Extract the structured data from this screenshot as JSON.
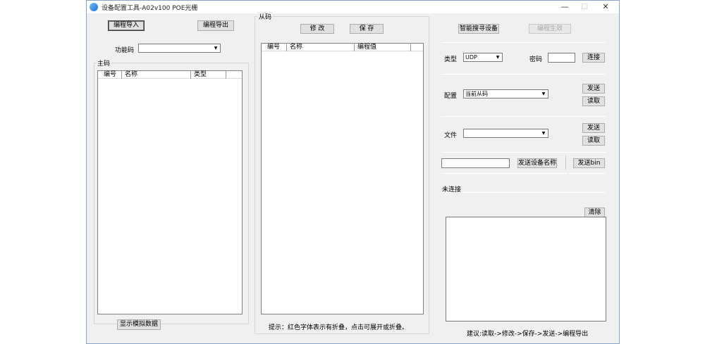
{
  "window": {
    "title": "设备配置工具-A02v100 POE光栅",
    "minimize": "—",
    "maximize": "☐",
    "close": "✕"
  },
  "left": {
    "import_button": "编程导入",
    "export_button": "编程导出",
    "function_code_label": "功能码",
    "function_code_value": "",
    "master_group_title": "主码",
    "master_columns": [
      "编号",
      "名称",
      "类型"
    ],
    "show_sim_button": "显示模拟数据"
  },
  "middle": {
    "slave_group_title": "从码",
    "modify_button": "修 改",
    "save_button": "保 存",
    "slave_columns": [
      "编号",
      "名称",
      "编程值"
    ],
    "hint": "提示：红色字体表示有折叠，点击可展开或折叠。"
  },
  "right": {
    "smart_search_button": "智能搜寻设备",
    "program_apply_button": "编程生效",
    "type_label": "类型",
    "type_value": "UDP",
    "password_label": "密码",
    "password_value": "",
    "connect_button": "连接",
    "config_label": "配置",
    "config_value": "当前从码",
    "config_send_button": "发送",
    "config_read_button": "读取",
    "file_label": "文件",
    "file_value": "",
    "file_send_button": "发送",
    "file_read_button": "读取",
    "device_name_value": "",
    "send_device_name_button": "发送设备名称",
    "send_bin_button": "发送bin",
    "status_text": "未连接",
    "clear_button": "清除",
    "suggestion": "建议:读取->修改->保存->发送->编程导出"
  }
}
